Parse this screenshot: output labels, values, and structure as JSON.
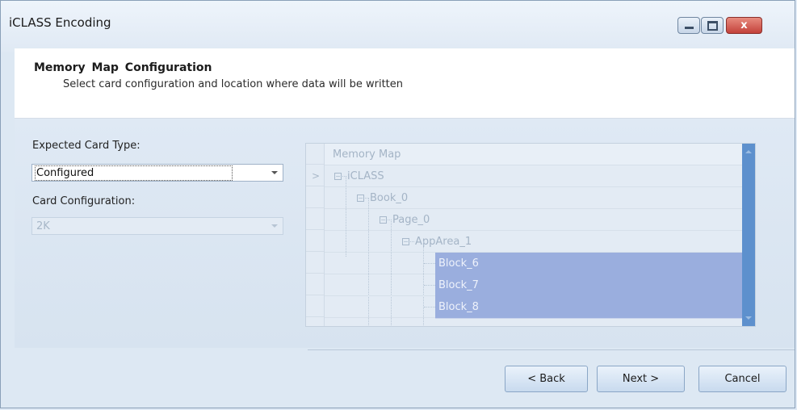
{
  "window": {
    "title": "iCLASS Encoding",
    "controls": {
      "minimize": "minimize",
      "maximize": "maximize",
      "close": "x"
    }
  },
  "header": {
    "title": "Memory Map  Configuration",
    "subtitle": "Select card configuration and location where data will be written"
  },
  "form": {
    "card_type_label": "Expected Card Type:",
    "card_type_value": "Configured",
    "card_config_label": "Card Configuration:",
    "card_config_value": "2K"
  },
  "memory_map": {
    "column_header": "Memory Map",
    "row_indicator": ">",
    "rows": [
      {
        "label": "iCLASS",
        "selected": false
      },
      {
        "label": "Book_0",
        "selected": false
      },
      {
        "label": "Page_0",
        "selected": false
      },
      {
        "label": "AppArea_1",
        "selected": false
      },
      {
        "label": "Block_6",
        "selected": true
      },
      {
        "label": "Block_7",
        "selected": true
      },
      {
        "label": "Block_8",
        "selected": true
      }
    ]
  },
  "buttons": {
    "back": "< Back",
    "next": "Next >",
    "cancel": "Cancel"
  },
  "colors": {
    "selection": "#9aaede",
    "scrollbar": "#5d90cd",
    "close_button": "#c3413a"
  }
}
